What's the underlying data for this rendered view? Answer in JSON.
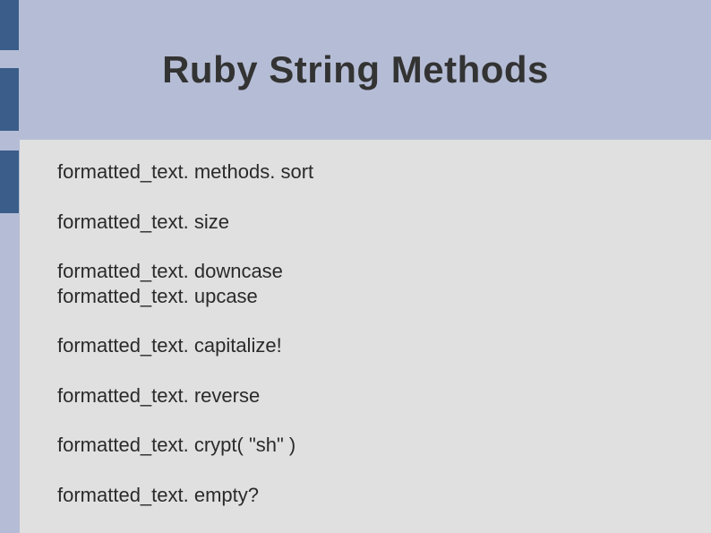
{
  "title": "Ruby String Methods",
  "body": {
    "p1": {
      "l1": "formatted_text. methods. sort"
    },
    "p2": {
      "l1": "formatted_text. size"
    },
    "p3": {
      "l1": "formatted_text. downcase",
      "l2": "formatted_text. upcase"
    },
    "p4": {
      "l1": "formatted_text. capitalize!"
    },
    "p5": {
      "l1": "formatted_text. reverse"
    },
    "p6": {
      "l1": "formatted_text. crypt( \"sh\" )"
    },
    "p7": {
      "l1": "formatted_text. empty?"
    }
  }
}
